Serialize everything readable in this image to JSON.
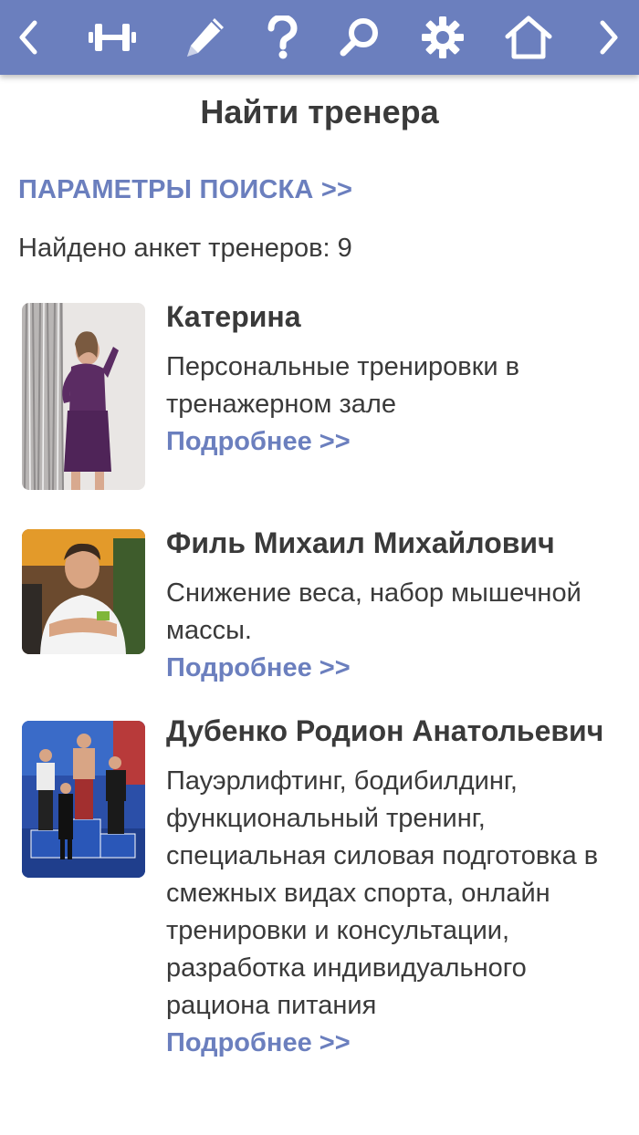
{
  "toolbar": {
    "icons": [
      "back-icon",
      "dumbbell-icon",
      "pen-icon",
      "help-icon",
      "search-icon",
      "settings-icon",
      "home-icon",
      "forward-icon"
    ],
    "background": "#6b7fbe"
  },
  "page": {
    "title": "Найти тренера",
    "search_params_link": "ПАРАМЕТРЫ ПОИСКА >>",
    "found_text": "Найдено анкет тренеров: 9"
  },
  "trainers": [
    {
      "name": "Катерина",
      "description": "Персональные тренировки в тренажерном зале",
      "more_link": "Подробнее >>"
    },
    {
      "name": "Филь Михаил Михайлович",
      "description": "Снижение веса, набор мышечной массы.",
      "more_link": "Подробнее >>"
    },
    {
      "name": "Дубенко Родион Анатольевич",
      "description": "Пауэрлифтинг, бодибилдинг, функциональный тренинг, специальная силовая подготовка в смежных видах спорта, онлайн тренировки и консультации, разработка индивидуального рациона питания",
      "more_link": "Подробнее >>"
    }
  ],
  "colors": {
    "accent": "#6b7fbe",
    "text": "#3a3a3a"
  }
}
